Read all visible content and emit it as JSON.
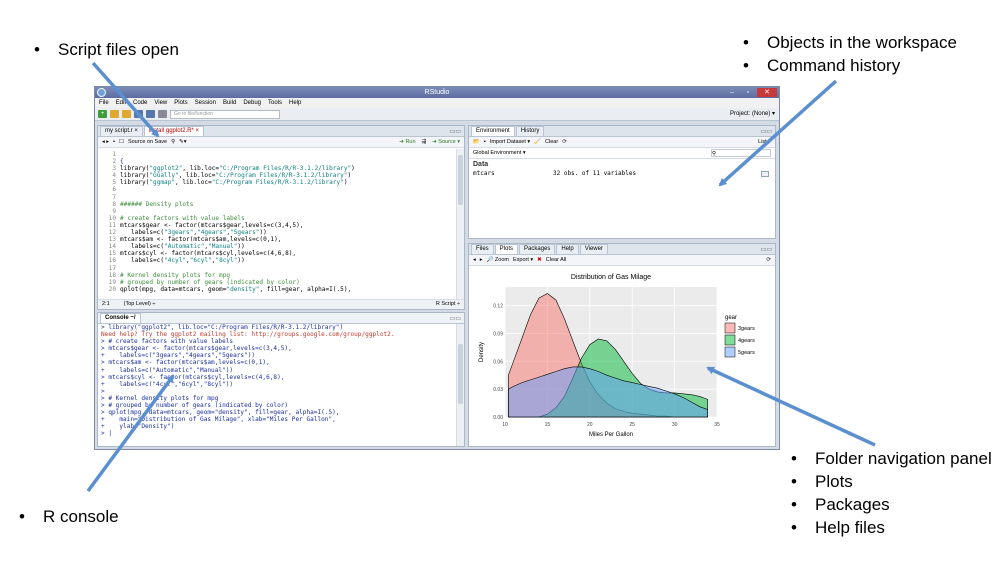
{
  "annotations": {
    "top_left": [
      "Script files open"
    ],
    "top_right": [
      "Objects in the workspace",
      "Command history"
    ],
    "bottom_left": [
      "R console"
    ],
    "bottom_right": [
      "Folder navigation panel",
      "Plots",
      "Packages",
      "Help files"
    ]
  },
  "window": {
    "title": "RStudio",
    "menu": [
      "File",
      "Edit",
      "Code",
      "View",
      "Plots",
      "Session",
      "Build",
      "Debug",
      "Tools",
      "Help"
    ],
    "goto_placeholder": "Go to file/function",
    "project": "Project: (None) ▾"
  },
  "editor": {
    "tabs": [
      "my script.r ×",
      "install ggplot2.R* ×"
    ],
    "source_on_save": "Source on Save",
    "run_label": "Run",
    "source_label": "Source ▾",
    "line_numbers": [
      "1",
      "2",
      "3",
      "4",
      "5",
      "6",
      "7",
      "8",
      "9",
      "10",
      "11",
      "12",
      "13",
      "14",
      "15",
      "16",
      "17",
      "18",
      "19",
      "20"
    ],
    "status_pos": "2:1",
    "status_scope": "(Top Level) ÷",
    "status_type": "R Script ÷"
  },
  "console": {
    "title": "Console ~/",
    "lines": [
      "> library(\"ggplot2\", lib.loc=\"C:/Program Files/R/R-3.1.2/library\")",
      "Need help? Try the ggplot2 mailing list: http://groups.google.com/group/ggplot2.",
      "> # create factors with value labels",
      "> mtcars$gear <- factor(mtcars$gear,levels=c(3,4,5),",
      "+    labels=c(\"3gears\",\"4gears\",\"5gears\"))",
      "> mtcars$am <- factor(mtcars$am,levels=c(0,1),",
      "+    labels=c(\"Automatic\",\"Manual\"))",
      "> mtcars$cyl <- factor(mtcars$cyl,levels=c(4,6,8),",
      "+    labels=c(\"4cyl\",\"6cyl\",\"8cyl\"))",
      ">",
      "> # Kernel density plots for mpg",
      "> # grouped by number of gears (indicated by color)",
      "> qplot(mpg, data=mtcars, geom=\"density\", fill=gear, alpha=I(.5),",
      "+    main=\"Distribution of Gas Milage\", xlab=\"Miles Per Gallon\",",
      "+    ylab=\"Density\")",
      "> |"
    ]
  },
  "environment": {
    "tabs": [
      "Environment",
      "History"
    ],
    "import_label": "Import Dataset ▾",
    "clear_label": "Clear",
    "list_label": "List ▾",
    "scope": "Global Environment ▾",
    "section": "Data",
    "rows": [
      {
        "name": "mtcars",
        "desc": "32 obs. of 11 variables"
      }
    ]
  },
  "files": {
    "tabs": [
      "Files",
      "Plots",
      "Packages",
      "Help",
      "Viewer"
    ],
    "zoom_label": "Zoom",
    "export_label": "Export ▾",
    "clear_all_label": "Clear All"
  },
  "chart_data": {
    "type": "area",
    "title": "Distribution of Gas Milage",
    "xlabel": "Miles Per Gallon",
    "ylabel": "Density",
    "xlim": [
      10,
      35
    ],
    "ylim": [
      0,
      0.14
    ],
    "x_ticks": [
      10,
      15,
      20,
      25,
      30,
      35
    ],
    "y_ticks": [
      0.0,
      0.03,
      0.06,
      0.09,
      0.12
    ],
    "y_tick_labels": [
      "0.00",
      "0.03",
      "0.06",
      "0.09",
      "0.12"
    ],
    "legend_title": "gear",
    "legend_position": "right",
    "grid": true,
    "x": [
      10.4,
      11,
      12,
      13,
      14,
      15,
      16,
      17,
      18,
      19,
      20,
      21,
      22,
      23,
      24,
      25,
      26,
      27,
      28,
      29,
      30,
      31,
      32,
      33,
      33.9
    ],
    "series": [
      {
        "name": "3gears",
        "color": "#f8766d",
        "values": [
          0.045,
          0.06,
          0.085,
          0.11,
          0.128,
          0.133,
          0.126,
          0.106,
          0.082,
          0.058,
          0.038,
          0.024,
          0.015,
          0.009,
          0.006,
          0.004,
          0.003,
          0.002,
          0.001,
          0.001,
          0.0,
          0.0,
          0.0,
          0.0,
          0.0
        ]
      },
      {
        "name": "4gears",
        "color": "#00ba38",
        "values": [
          0.0,
          0.0,
          0.0,
          0.0,
          0.0,
          0.003,
          0.01,
          0.022,
          0.042,
          0.063,
          0.078,
          0.084,
          0.082,
          0.073,
          0.06,
          0.047,
          0.036,
          0.03,
          0.027,
          0.026,
          0.026,
          0.025,
          0.024,
          0.022,
          0.019
        ]
      },
      {
        "name": "5gears",
        "color": "#619cff",
        "values": [
          0.03,
          0.033,
          0.037,
          0.04,
          0.043,
          0.046,
          0.049,
          0.052,
          0.054,
          0.054,
          0.052,
          0.049,
          0.045,
          0.042,
          0.039,
          0.037,
          0.035,
          0.033,
          0.031,
          0.028,
          0.025,
          0.021,
          0.016,
          0.011,
          0.008
        ]
      }
    ]
  },
  "colors": {
    "arrow": "#5b8fcf",
    "unsaved_tab": "#c00000",
    "console_text": "#1a2fa0"
  }
}
